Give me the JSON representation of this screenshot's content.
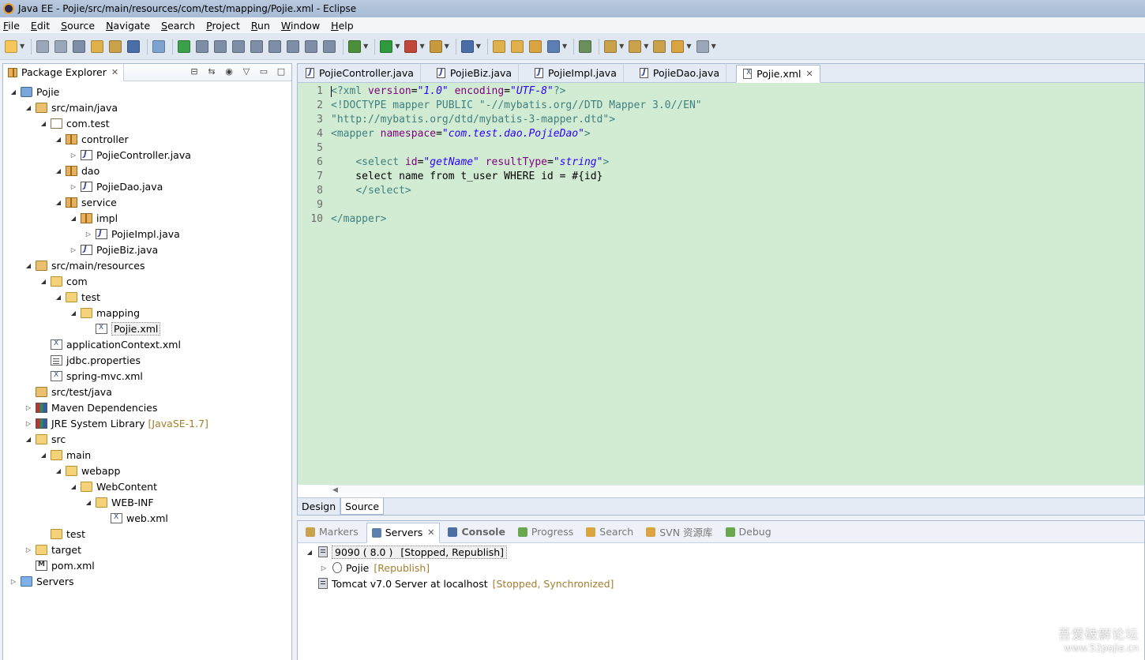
{
  "window": {
    "title": "Java EE - Pojie/src/main/resources/com/test/mapping/Pojie.xml - Eclipse"
  },
  "menu": [
    "File",
    "Edit",
    "Source",
    "Navigate",
    "Search",
    "Project",
    "Run",
    "Window",
    "Help"
  ],
  "toolbar": {
    "icons": [
      "new-icon",
      "save-icon",
      "save-all-icon",
      "print-icon",
      "open-type-icon",
      "open-task-icon",
      "terminal-icon",
      "skip-breakpoints-icon",
      "resume-icon",
      "suspend-icon",
      "terminate-icon",
      "disconnect-icon",
      "step-into-icon",
      "step-over-icon",
      "step-return-icon",
      "drop-to-frame-icon",
      "use-step-filters-icon",
      "debug-icon",
      "run-icon",
      "external-tools-icon",
      "new-server-icon",
      "new-java-class-icon",
      "open-folder-icon",
      "open-file-icon",
      "search-icon",
      "globe-icon",
      "annotation-icon",
      "next-annotation-icon",
      "prev-annotation-icon",
      "last-edit-icon",
      "back-icon",
      "forward-icon"
    ]
  },
  "package_explorer": {
    "title": "Package Explorer",
    "tree": [
      {
        "label": "Pojie",
        "depth": 0,
        "expanded": "open",
        "icon": "project"
      },
      {
        "label": "src/main/java",
        "depth": 1,
        "expanded": "open",
        "icon": "srcfolder"
      },
      {
        "label": "com.test",
        "depth": 2,
        "expanded": "open",
        "icon": "package-empty"
      },
      {
        "label": "controller",
        "depth": 3,
        "expanded": "open",
        "icon": "package"
      },
      {
        "label": "PojieController.java",
        "depth": 4,
        "expanded": "closed",
        "icon": "java"
      },
      {
        "label": "dao",
        "depth": 3,
        "expanded": "open",
        "icon": "package"
      },
      {
        "label": "PojieDao.java",
        "depth": 4,
        "expanded": "closed",
        "icon": "java"
      },
      {
        "label": "service",
        "depth": 3,
        "expanded": "open",
        "icon": "package"
      },
      {
        "label": "impl",
        "depth": 4,
        "expanded": "open",
        "icon": "package"
      },
      {
        "label": "PojieImpl.java",
        "depth": 5,
        "expanded": "closed",
        "icon": "java"
      },
      {
        "label": "PojieBiz.java",
        "depth": 4,
        "expanded": "closed",
        "icon": "java"
      },
      {
        "label": "src/main/resources",
        "depth": 1,
        "expanded": "open",
        "icon": "srcfolder"
      },
      {
        "label": "com",
        "depth": 2,
        "expanded": "open",
        "icon": "folder"
      },
      {
        "label": "test",
        "depth": 3,
        "expanded": "open",
        "icon": "folder"
      },
      {
        "label": "mapping",
        "depth": 4,
        "expanded": "open",
        "icon": "folder"
      },
      {
        "label": "Pojie.xml",
        "depth": 5,
        "expanded": "none",
        "icon": "xml",
        "selected": true
      },
      {
        "label": "applicationContext.xml",
        "depth": 2,
        "expanded": "none",
        "icon": "xml"
      },
      {
        "label": "jdbc.properties",
        "depth": 2,
        "expanded": "none",
        "icon": "props"
      },
      {
        "label": "spring-mvc.xml",
        "depth": 2,
        "expanded": "none",
        "icon": "xml"
      },
      {
        "label": "src/test/java",
        "depth": 1,
        "expanded": "none",
        "icon": "srcfolder"
      },
      {
        "label": "Maven Dependencies",
        "depth": 1,
        "expanded": "closed",
        "icon": "lib"
      },
      {
        "label": "JRE System Library",
        "depth": 1,
        "expanded": "closed",
        "icon": "lib",
        "decor": "[JavaSE-1.7]"
      },
      {
        "label": "src",
        "depth": 1,
        "expanded": "open",
        "icon": "folder"
      },
      {
        "label": "main",
        "depth": 2,
        "expanded": "open",
        "icon": "folder"
      },
      {
        "label": "webapp",
        "depth": 3,
        "expanded": "open",
        "icon": "folder"
      },
      {
        "label": "WebContent",
        "depth": 4,
        "expanded": "open",
        "icon": "folder"
      },
      {
        "label": "WEB-INF",
        "depth": 5,
        "expanded": "open",
        "icon": "folder"
      },
      {
        "label": "web.xml",
        "depth": 6,
        "expanded": "none",
        "icon": "xml"
      },
      {
        "label": "test",
        "depth": 2,
        "expanded": "none",
        "icon": "folder"
      },
      {
        "label": "target",
        "depth": 1,
        "expanded": "closed",
        "icon": "folder"
      },
      {
        "label": "pom.xml",
        "depth": 1,
        "expanded": "none",
        "icon": "pom"
      },
      {
        "label": "Servers",
        "depth": 0,
        "expanded": "closed",
        "icon": "servers-folder"
      }
    ]
  },
  "editor": {
    "tabs": [
      {
        "label": "PojieController.java",
        "icon": "java",
        "active": false
      },
      {
        "label": "PojieBiz.java",
        "icon": "java",
        "active": false
      },
      {
        "label": "PojieImpl.java",
        "icon": "java",
        "active": false
      },
      {
        "label": "PojieDao.java",
        "icon": "java",
        "active": false
      },
      {
        "label": "Pojie.xml",
        "icon": "xml",
        "active": true
      }
    ],
    "line_numbers": [
      "1",
      "2",
      "3",
      "4",
      "5",
      "6",
      "7",
      "8",
      "9",
      "10"
    ],
    "code_lines": [
      [
        [
          "tag",
          "<?xml "
        ],
        [
          "attr",
          "version"
        ],
        [
          "txt",
          "="
        ],
        [
          "val",
          "\"1.0\""
        ],
        [
          "txt",
          " "
        ],
        [
          "attr",
          "encoding"
        ],
        [
          "txt",
          "="
        ],
        [
          "val",
          "\"UTF-8\""
        ],
        [
          "tag",
          "?>"
        ]
      ],
      [
        [
          "doctype",
          "<!DOCTYPE mapper PUBLIC \"-//mybatis.org//DTD Mapper 3.0//EN\""
        ]
      ],
      [
        [
          "doctype",
          "\"http://mybatis.org/dtd/mybatis-3-mapper.dtd\">"
        ]
      ],
      [
        [
          "tag",
          "<mapper "
        ],
        [
          "attr",
          "namespace"
        ],
        [
          "txt",
          "="
        ],
        [
          "val",
          "\"com.test.dao.PojieDao\""
        ],
        [
          "tag",
          ">"
        ]
      ],
      [],
      [
        [
          "txt",
          "    "
        ],
        [
          "tag",
          "<select "
        ],
        [
          "attr",
          "id"
        ],
        [
          "txt",
          "="
        ],
        [
          "val",
          "\"getName\""
        ],
        [
          "txt",
          " "
        ],
        [
          "attr",
          "resultType"
        ],
        [
          "txt",
          "="
        ],
        [
          "val",
          "\"string\""
        ],
        [
          "tag",
          ">"
        ]
      ],
      [
        [
          "txt",
          "    select name from t_user WHERE id = #{id}"
        ]
      ],
      [
        [
          "txt",
          "    "
        ],
        [
          "tag",
          "</select>"
        ]
      ],
      [],
      [
        [
          "tag",
          "</mapper>"
        ]
      ]
    ],
    "bottom_tabs": [
      {
        "label": "Design",
        "active": false
      },
      {
        "label": "Source",
        "active": true
      }
    ]
  },
  "bottom_panel": {
    "tabs": [
      {
        "label": "Markers",
        "active": false,
        "bold": false,
        "color": "#c9a24b"
      },
      {
        "label": "Servers",
        "active": true,
        "bold": false,
        "color": "#5d7fb0"
      },
      {
        "label": "Console",
        "active": false,
        "bold": true,
        "color": "#4a6fa5"
      },
      {
        "label": "Progress",
        "active": false,
        "bold": false,
        "color": "#6aa84f"
      },
      {
        "label": "Search",
        "active": false,
        "bold": false,
        "color": "#d9a441"
      },
      {
        "label": "SVN 资源库",
        "active": false,
        "bold": false,
        "color": "#d9a441"
      },
      {
        "label": "Debug",
        "active": false,
        "bold": false,
        "color": "#6aa84f"
      }
    ],
    "servers": [
      {
        "label": "9090 ( 8.0 )",
        "status": "[Stopped, Republish]",
        "depth": 0,
        "expanded": "open",
        "icon": "server",
        "highlighted": true
      },
      {
        "label": "Pojie",
        "status": "[Republish]",
        "depth": 1,
        "expanded": "closed",
        "icon": "module",
        "highlighted": false
      },
      {
        "label": "Tomcat v7.0 Server at localhost",
        "status": "[Stopped, Synchronized]",
        "depth": 0,
        "expanded": "none",
        "icon": "server",
        "highlighted": false
      }
    ]
  },
  "watermark": {
    "line1": "吾爱破解论坛",
    "line2": "www.52pojie.cn"
  },
  "colors": {
    "code_bg": "#d2ecd3",
    "tag": "#3f7f7f",
    "attr": "#7f007f",
    "value": "#2a00ff",
    "decoration": "#a47d2e"
  }
}
